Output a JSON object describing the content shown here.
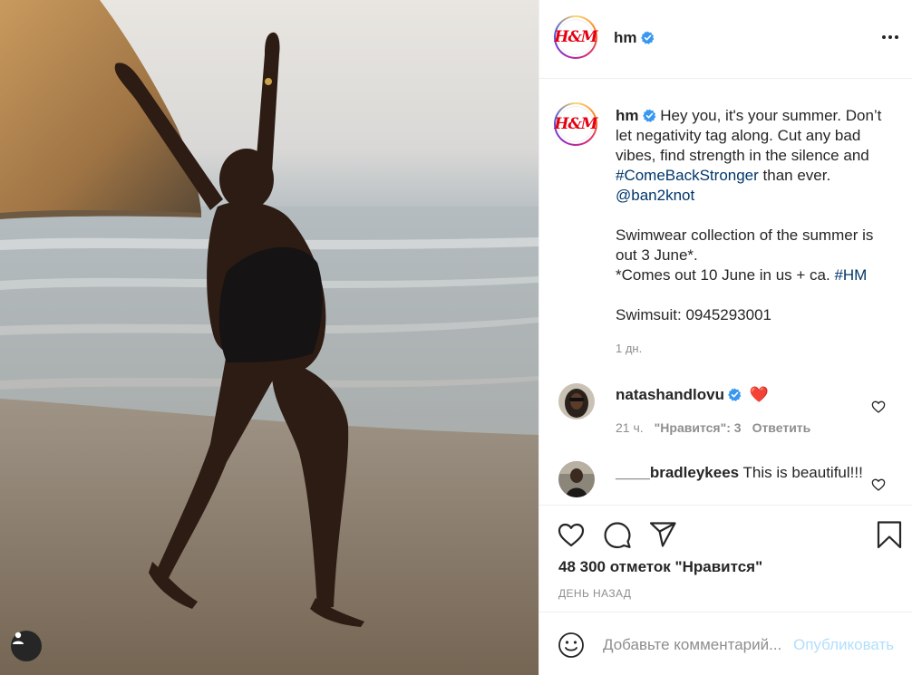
{
  "post": {
    "username": "hm",
    "avatar_logo": "H&M",
    "verified": true,
    "caption_parts": {
      "text1": "Hey you, it's your summer. Don’t let negativity tag along. Cut any bad vibes, find strength in the silence and ",
      "hashtag1": "#ComeBackStronger",
      "text2": " than ever.",
      "mention": "@ban2knot",
      "para2": "Swimwear collection of the summer is out 3 June*.",
      "para3_text": "*Comes out 10 June in us + ca. ",
      "hashtag2": "#HM",
      "para4": "Swimsuit: 0945293001"
    },
    "caption_time": "1 дн.",
    "likes_text": "48 300 отметок \"Нравится\"",
    "post_time": "ДЕНЬ НАЗАД"
  },
  "comments": [
    {
      "username": "natashandlovu",
      "verified": true,
      "text": "❤️",
      "time": "21 ч.",
      "likes": "\"Нравится\": 3",
      "reply": "Ответить"
    },
    {
      "username": "____bradleykees",
      "verified": false,
      "text": "This is beautiful!!!"
    }
  ],
  "add_comment": {
    "placeholder": "Добавьте комментарий...",
    "publish_label": "Опубликовать"
  },
  "icons": {
    "more": "more-options-icon",
    "like": "heart-icon",
    "comment": "comment-bubble-icon",
    "share": "paper-plane-icon",
    "save": "bookmark-icon",
    "emoji": "emoji-icon",
    "user": "user-tag-icon"
  },
  "colors": {
    "link": "#00376b",
    "verified": "#3897f0",
    "brand": "#e50010",
    "publish_disabled": "#b2dffc"
  }
}
